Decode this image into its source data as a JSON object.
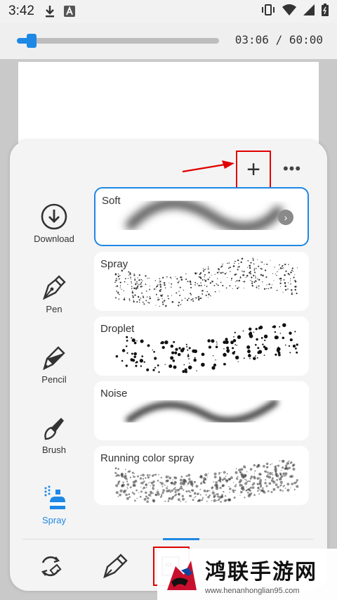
{
  "status_bar": {
    "time": "3:42"
  },
  "timeline": {
    "progress_fraction": 0.05,
    "readout": "03:06 / 60:00"
  },
  "panel": {
    "add_button": "+",
    "more_button": "•••",
    "categories": [
      {
        "label": "Download",
        "icon": "download-icon",
        "active": false
      },
      {
        "label": "Pen",
        "icon": "pen-icon",
        "active": false
      },
      {
        "label": "Pencil",
        "icon": "pencil-icon",
        "active": false
      },
      {
        "label": "Brush",
        "icon": "brush-icon",
        "active": false
      },
      {
        "label": "Spray",
        "icon": "spray-icon",
        "active": true
      }
    ],
    "brushes": [
      {
        "name": "Soft",
        "selected": true
      },
      {
        "name": "Spray",
        "selected": false
      },
      {
        "name": "Droplet",
        "selected": false
      },
      {
        "name": "Noise",
        "selected": false
      },
      {
        "name": "Running color spray",
        "selected": false
      }
    ]
  },
  "toolbar": {
    "tools": [
      "swap-color-icon",
      "brush-tool-icon",
      "layers-icon"
    ],
    "active_index": 2
  },
  "watermark": {
    "title": "鸿联手游网",
    "url": "www.henanhonglian95.com"
  },
  "colors": {
    "accent": "#1e88e5",
    "annotation": "#e00000"
  }
}
